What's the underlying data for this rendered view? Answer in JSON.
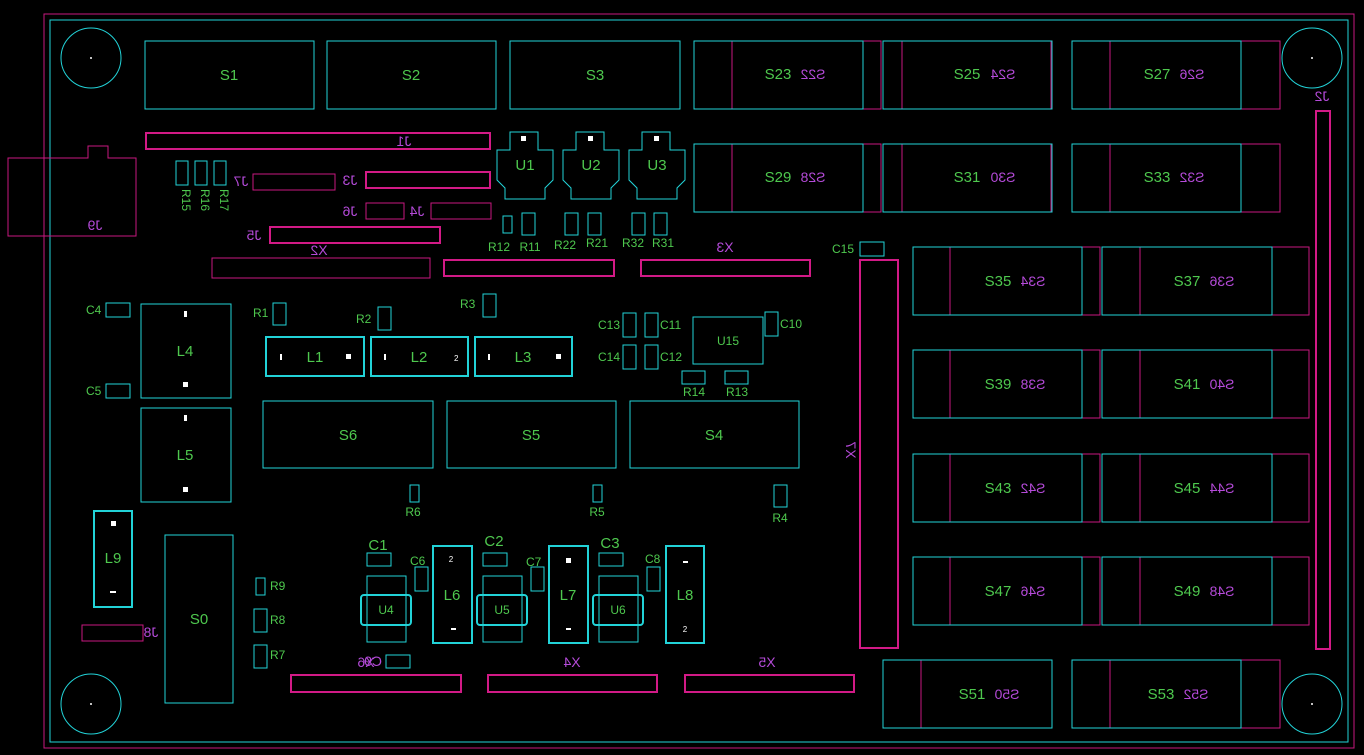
{
  "colors": {
    "background": "#000000",
    "outline_top": "#22d3d8",
    "outline_bottom": "#c8197f",
    "label_top": "#4ec84e",
    "label_bottom": "#b44ad8"
  },
  "switches_top_row": [
    "S1",
    "S2",
    "S3"
  ],
  "switch_pairs": [
    {
      "top": "S23",
      "bottom": "S22"
    },
    {
      "top": "S25",
      "bottom": "S24"
    },
    {
      "top": "S27",
      "bottom": "S26"
    },
    {
      "top": "S29",
      "bottom": "S28"
    },
    {
      "top": "S31",
      "bottom": "S30"
    },
    {
      "top": "S33",
      "bottom": "S32"
    },
    {
      "top": "S35",
      "bottom": "S34"
    },
    {
      "top": "S37",
      "bottom": "S36"
    },
    {
      "top": "S39",
      "bottom": "S38"
    },
    {
      "top": "S41",
      "bottom": "S40"
    },
    {
      "top": "S43",
      "bottom": "S42"
    },
    {
      "top": "S45",
      "bottom": "S44"
    },
    {
      "top": "S47",
      "bottom": "S46"
    },
    {
      "top": "S49",
      "bottom": "S48"
    },
    {
      "top": "S51",
      "bottom": "S50"
    },
    {
      "top": "S53",
      "bottom": "S52"
    }
  ],
  "switches_mid": [
    "S6",
    "S5",
    "S4"
  ],
  "switch_s0": "S0",
  "regulators": [
    "U1",
    "U2",
    "U3"
  ],
  "chips": {
    "u15": "U15",
    "u4": "U4",
    "u5": "U5",
    "u6": "U6"
  },
  "inductors": [
    "L1",
    "L2",
    "L3",
    "L4",
    "L5",
    "L6",
    "L7",
    "L8",
    "L9"
  ],
  "resistors": {
    "r1": "R1",
    "r2": "R2",
    "r3": "R3",
    "r4": "R4",
    "r5": "R5",
    "r6": "R6",
    "r7": "R7",
    "r8": "R8",
    "r9": "R9",
    "r11": "R11",
    "r12": "R12",
    "r13": "R13",
    "r14": "R14",
    "r15": "R15",
    "r16": "R16",
    "r17": "R17",
    "r21": "R21",
    "r22": "R22",
    "r31": "R31",
    "r32": "R32"
  },
  "capacitors": {
    "c1": "C1",
    "c2": "C2",
    "c3": "C3",
    "c4": "C4",
    "c5": "C5",
    "c6": "C6",
    "c7": "C7",
    "c8": "C8",
    "c10": "C10",
    "c11": "C11",
    "c12": "C12",
    "c13": "C13",
    "c14": "C14",
    "c15": "C15",
    "c9": "C9"
  },
  "connectors": {
    "j1": "J1",
    "j2": "J2",
    "j3": "J3",
    "j4": "J4",
    "j5": "J5",
    "j6": "J6",
    "j7": "J7",
    "j8": "J8",
    "j9": "J9",
    "x2": "X2",
    "x3": "X3",
    "x4": "X4",
    "x5": "X5",
    "x6": "X6",
    "x7": "X7"
  },
  "pin_numbers": {
    "one": "1",
    "two": "2"
  }
}
